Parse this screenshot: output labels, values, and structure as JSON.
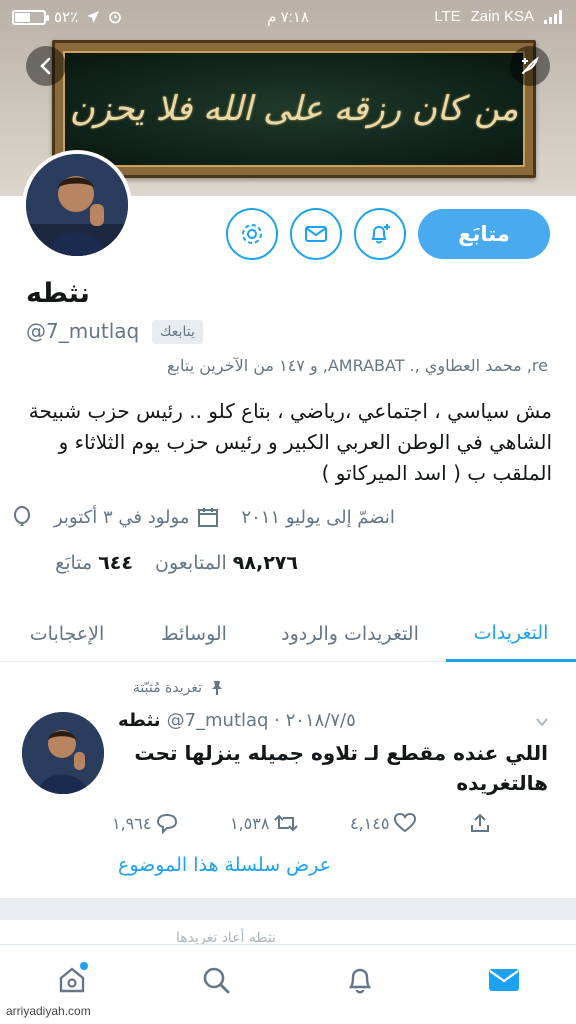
{
  "status_bar": {
    "battery_text": "٥٢٪",
    "battery_level": 0.52,
    "time": "٧:١٨ م",
    "network": "LTE",
    "carrier": "Zain KSA"
  },
  "header": {
    "banner_text": "من كان رزقه على الله فلا يحزن"
  },
  "profile": {
    "name": "نثطه",
    "handle": "@7_mutlaq",
    "follows_you": "يتابعك",
    "followed_by": "re, محمد العطاوي ,. AMRABAT, و ١٤٧ من الآخرين يتابع",
    "bio": "مش سياسي ، اجتماعي ،رياضي ، بتاع كلو .. رئيس حزب شبيحة الشاهي في الوطن العربي الكبير و رئيس حزب يوم الثلاثاء و الملقب ب ( اسد الميركاتو )",
    "joined": "انضمّ إلى يوليو ٢٠١١",
    "birthday": "مولود في ٣ أكتوبر",
    "followers_count": "٩٨,٢٧٦",
    "followers_label": "المتابعون",
    "following_count": "٦٤٤",
    "following_label": "متابَع",
    "follow_button": "متابَع"
  },
  "tabs": [
    {
      "label": "التغريدات",
      "active": true
    },
    {
      "label": "التغريدات والردود",
      "active": false
    },
    {
      "label": "الوسائط",
      "active": false
    },
    {
      "label": "الإعجابات",
      "active": false
    }
  ],
  "tweet": {
    "pinned_label": "تغريدة مُثبّتة",
    "name": "نثطه",
    "meta": "@7_mutlaq · ٢٠١٨/٧/٥",
    "text": "اللي عنده مقطع لـ تلاوه جميله ينزلها تحت هالتغريده",
    "replies": "١,٩٦٤",
    "retweets": "١,٥٣٨",
    "likes": "٤,١٤٥",
    "thread_link": "عرض سلسلة هذا الموضوع"
  },
  "next_item_text": "نثطه أعاد تغريدها",
  "watermark": "arriyadiyah.com",
  "colors": {
    "accent": "#1da1f2",
    "secondary_text": "#657786"
  }
}
